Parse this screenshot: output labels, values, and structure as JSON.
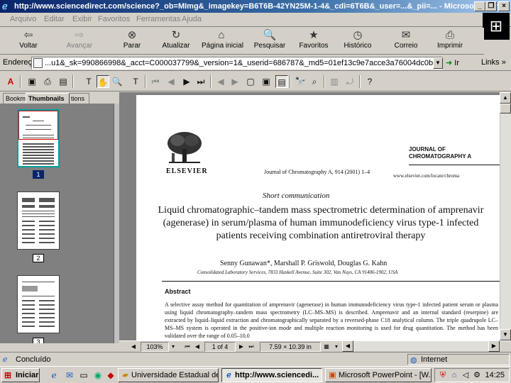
{
  "window": {
    "title": "http://www.sciencedirect.com/science?_ob=MImg&_imagekey=B6T6B-42YN25M-1-4&_cdi=6T6B&_user=...&_pii=... - Microsoft Internet Explorer",
    "minimize": "_",
    "maximize": "❐",
    "close": "×"
  },
  "menu": [
    "Arquivo",
    "Editar",
    "Exibir",
    "Favoritos",
    "Ferramentas",
    "Ajuda"
  ],
  "toolbar": {
    "back": "Voltar",
    "forward": "Avançar",
    "stop": "Parar",
    "refresh": "Atualizar",
    "home": "Página inicial",
    "search": "Pesquisar",
    "favorites": "Favoritos",
    "history": "Histórico",
    "mail": "Correio",
    "print": "Imprimir"
  },
  "address": {
    "label": "Endereço",
    "value": "...u1&_sk=990866998&_acct=C000037799&_version=1&_userid=686787&_md5=01ef13c9e7acce3a76004dc0b5f95a7&ie=f.pdf",
    "go": "Ir",
    "links": "Links »"
  },
  "leftpanel": {
    "tab_bookmarks": "Bookm",
    "tab_thumbnails": "Thumbnails",
    "tab_annotations": "tions",
    "thumbs": [
      {
        "label": "1"
      },
      {
        "label": "2"
      },
      {
        "label": "3"
      }
    ]
  },
  "document": {
    "publisher": "ELSEVIER",
    "journal_cite": "Journal of Chromatography A, 914 (2001) 1–4",
    "journal_name_1": "JOURNAL OF",
    "journal_name_2": "CHROMATOGRAPHY A",
    "journal_url": "www.elsevier.com/locate/chroma",
    "article_type": "Short communication",
    "title": "Liquid chromatographic–tandem mass spectrometric determination of amprenavir (agenerase) in serum/plasma of human immunodeficiency virus type-1 infected patients receiving combination antiretroviral therapy",
    "authors": "Senny Gunawan*, Marshall P. Griswold, Douglas G. Kahn",
    "affiliation": "Consolidated Laboratory Services, 7833 Haskell Avenue, Suite 302, Van Nuys, CA 91406-1902, USA",
    "abstract_head": "Abstract",
    "abstract_text": "A selective assay method for quantitation of amprenavir (agenerase) in human immunodeficiency virus type-1 infected patient serum or plasma using liquid chromatography–tandem mass spectrometry (LC–MS–MS) is described. Amprenavir and an internal standard (reserpine) are extracted by liquid–liquid extraction and chromatographically separated by a reversed-phase C18 analytical column. The triple quadrupole LC–MS–MS system is operated in the positive-ion mode and multiple reaction monitoring is used for drug quantitation. The method has been validated over the range of 0.05–10.0"
  },
  "docstatus": {
    "zoom": "103%",
    "page": "1 of 4",
    "size": "7.59 × 10.39 in"
  },
  "iestatus": {
    "done": "Concluído",
    "zone": "Internet"
  },
  "taskbar": {
    "start": "Iniciar",
    "tasks": [
      {
        "label": "Universidade Estadual de ..."
      },
      {
        "label": "http://www.sciencedi..."
      },
      {
        "label": "Microsoft PowerPoint - [W..."
      }
    ],
    "clock": "14:25"
  }
}
